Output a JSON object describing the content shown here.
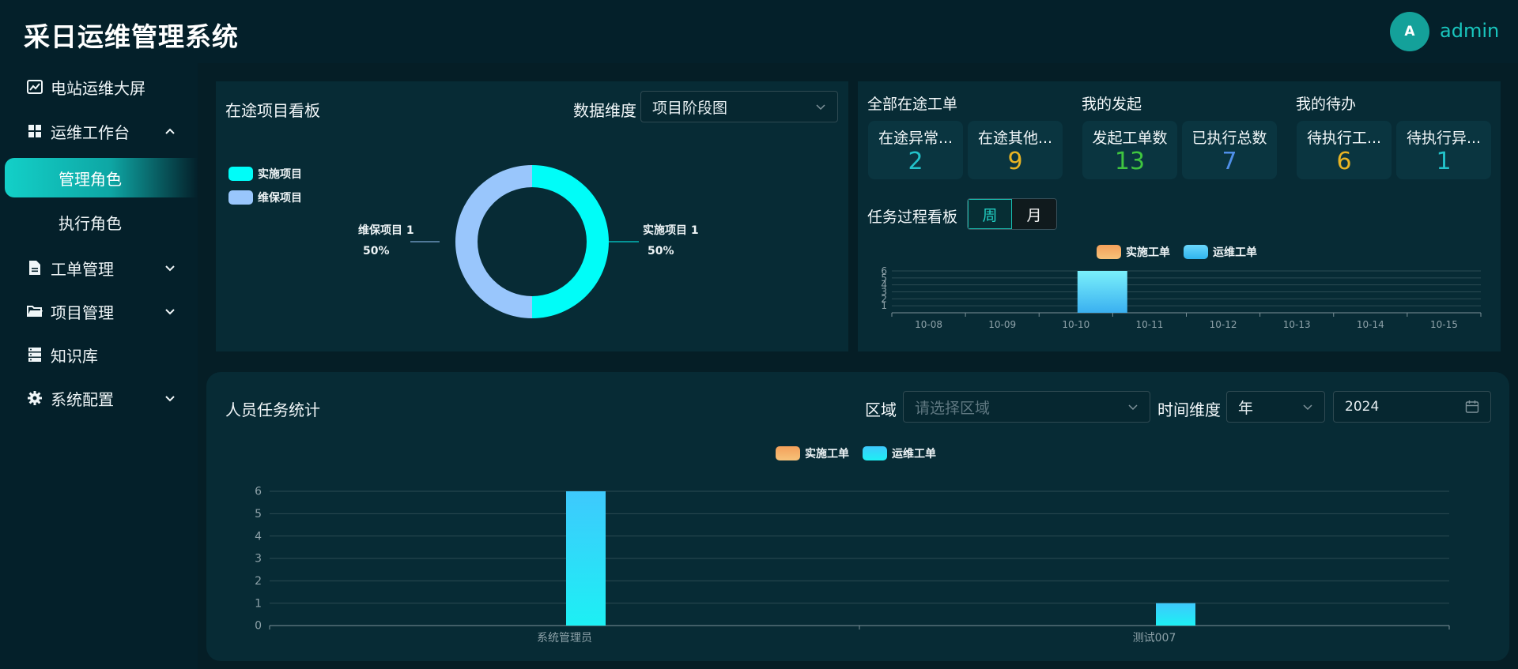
{
  "app": {
    "title": "采日运维管理系统",
    "avatar_letter": "A",
    "username": "admin"
  },
  "sidebar": {
    "items": [
      {
        "label": "电站运维大屏",
        "icon": "chart-line-icon"
      },
      {
        "label": "运维工作台",
        "icon": "grid-icon",
        "expanded": true
      },
      {
        "label": "管理角色",
        "sub": true,
        "active": true
      },
      {
        "label": "执行角色",
        "sub": true
      },
      {
        "label": "工单管理",
        "icon": "document-icon"
      },
      {
        "label": "项目管理",
        "icon": "folder-icon"
      },
      {
        "label": "知识库",
        "icon": "server-icon"
      },
      {
        "label": "系统配置",
        "icon": "gear-icon"
      }
    ]
  },
  "project_board": {
    "title": "在途项目看板",
    "dimension_label": "数据维度",
    "dimension_value": "项目阶段图",
    "chart_data": {
      "type": "pie",
      "categories": [
        "实施项目",
        "维保项目"
      ],
      "values": [
        1,
        1
      ],
      "percents": [
        "50%",
        "50%"
      ],
      "colors": [
        "#00fdf8",
        "#99c6fc"
      ],
      "labels": [
        "实施项目 1",
        "维保项目 1"
      ],
      "legend": "top-left"
    }
  },
  "workorders": {
    "groups": [
      {
        "title": "全部在途工单",
        "cards": [
          {
            "label": "在途异常...",
            "value": "2",
            "color": "#23c2c9"
          },
          {
            "label": "在途其他...",
            "value": "9",
            "color": "#e8b424"
          }
        ]
      },
      {
        "title": "我的发起",
        "cards": [
          {
            "label": "发起工单数",
            "value": "13",
            "color": "#3fc53f"
          },
          {
            "label": "已执行总数",
            "value": "7",
            "color": "#4f8fe8"
          }
        ]
      },
      {
        "title": "我的待办",
        "cards": [
          {
            "label": "待执行工...",
            "value": "6",
            "color": "#e8b424"
          },
          {
            "label": "待执行异...",
            "value": "1",
            "color": "#23c2c9"
          }
        ]
      }
    ]
  },
  "task_board": {
    "title": "任务过程看板",
    "toggle": [
      "周",
      "月"
    ],
    "legend": [
      "实施工单",
      "运维工单"
    ],
    "chart_data": {
      "type": "bar",
      "categories": [
        "10-08",
        "10-09",
        "10-10",
        "10-11",
        "10-12",
        "10-13",
        "10-14",
        "10-15"
      ],
      "series": [
        {
          "name": "实施工单",
          "values": [
            0,
            0,
            0,
            0,
            0,
            0,
            0,
            0
          ]
        },
        {
          "name": "运维工单",
          "values": [
            0,
            0,
            6,
            0,
            0,
            0,
            0,
            0
          ]
        }
      ],
      "y_ticks": [
        "1",
        "2",
        "3",
        "4",
        "5",
        "6"
      ],
      "ylim": [
        0,
        6
      ],
      "legend": "top"
    }
  },
  "staff_stats": {
    "title": "人员任务统计",
    "region_label": "区域",
    "region_placeholder": "请选择区域",
    "time_label": "时间维度",
    "time_value": "年",
    "year_value": "2024",
    "legend": [
      "实施工单",
      "运维工单"
    ],
    "chart_data": {
      "type": "bar",
      "categories": [
        "系统管理员",
        "测试007"
      ],
      "series": [
        {
          "name": "实施工单",
          "values": [
            0,
            0
          ]
        },
        {
          "name": "运维工单",
          "values": [
            6,
            1
          ]
        }
      ],
      "y_ticks": [
        "0",
        "1",
        "2",
        "3",
        "4",
        "5",
        "6"
      ],
      "ylim": [
        0,
        6
      ],
      "legend": "top"
    }
  },
  "colors": {
    "accent": "#19c5bd",
    "orange_series": "#f4a05a",
    "cyan_series": "#2ad6f4"
  }
}
